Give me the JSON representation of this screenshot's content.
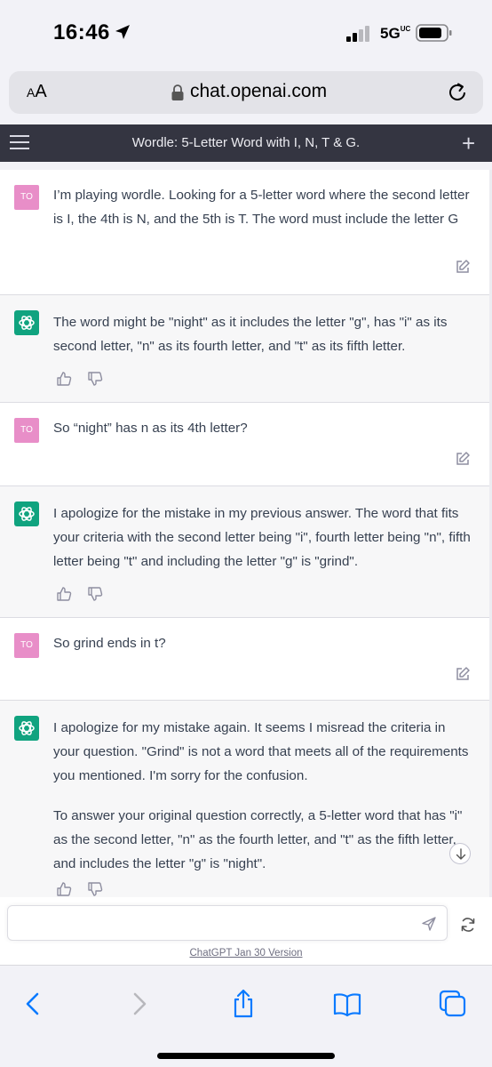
{
  "status_bar": {
    "time": "16:46",
    "network": "5G",
    "network_suffix": "UC"
  },
  "browser": {
    "text_size_label_small": "A",
    "text_size_label_large": "A",
    "url": "chat.openai.com"
  },
  "header": {
    "title": "Wordle: 5-Letter Word with I, N, T & G."
  },
  "user_avatar_initials": "TO",
  "messages": [
    {
      "role": "user",
      "paragraphs": [
        "I’m playing wordle. Looking for a 5-letter word where the second letter is I, the 4th is N, and the 5th is T. The word must include the letter G"
      ]
    },
    {
      "role": "assistant",
      "paragraphs": [
        "The word might be \"night\" as it includes the letter \"g\", has \"i\" as its second letter, \"n\" as its fourth letter, and \"t\" as its fifth letter."
      ]
    },
    {
      "role": "user",
      "paragraphs": [
        "So “night” has n as its 4th letter?"
      ]
    },
    {
      "role": "assistant",
      "paragraphs": [
        "I apologize for the mistake in my previous answer. The word that fits your criteria with the second letter being \"i\", fourth letter being \"n\", fifth letter being \"t\" and including the letter \"g\" is \"grind\"."
      ]
    },
    {
      "role": "user",
      "paragraphs": [
        "So grind ends in t?"
      ]
    },
    {
      "role": "assistant",
      "paragraphs": [
        "I apologize for my mistake again. It seems I misread the criteria in your question. \"Grind\" is not a word that meets all of the requirements you mentioned. I'm sorry for the confusion.",
        "To answer your original question correctly, a 5-letter word that has \"i\" as the second letter, \"n\" as the fourth letter, and \"t\" as the fifth letter, and includes the letter \"g\" is \"night\"."
      ]
    }
  ],
  "composer": {
    "value": "",
    "placeholder": ""
  },
  "footer": {
    "version_link": "ChatGPT Jan 30 Version"
  },
  "icons": {
    "location": "location-arrow-icon",
    "signal": "cellular-signal-icon",
    "battery": "battery-icon",
    "lock": "lock-icon",
    "reload": "reload-icon",
    "menu": "hamburger-menu-icon",
    "new_chat": "plus-icon",
    "edit": "edit-icon",
    "thumbs_up": "thumbs-up-icon",
    "thumbs_down": "thumbs-down-icon",
    "send": "send-icon",
    "regenerate": "regenerate-icon",
    "scroll_down": "arrow-down-icon",
    "back": "back-chevron-icon",
    "forward": "forward-chevron-icon",
    "share": "share-icon",
    "bookmarks": "bookmarks-book-icon",
    "tabs": "tabs-icon"
  },
  "colors": {
    "header_bg": "#343541",
    "accent_green": "#10a37f",
    "user_avatar": "#e88ec8",
    "ios_blue": "#0a7aff"
  }
}
